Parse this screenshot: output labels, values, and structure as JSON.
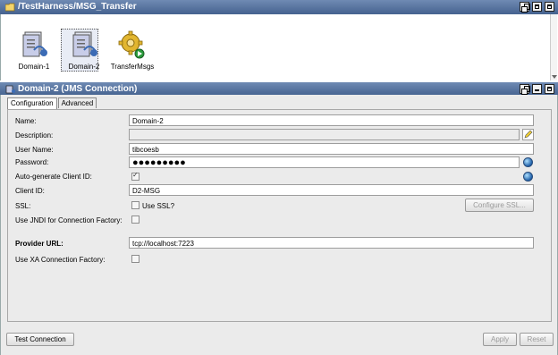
{
  "top_panel": {
    "title": "/TestHarness/MSG_Transfer",
    "resources": [
      {
        "label": "Domain-1"
      },
      {
        "label": "Domain-2"
      },
      {
        "label": "TransferMsgs"
      }
    ]
  },
  "config_panel": {
    "title": "Domain-2 (JMS Connection)",
    "tabs": [
      "Configuration",
      "Advanced"
    ]
  },
  "form": {
    "name_label": "Name:",
    "name_value": "Domain-2",
    "description_label": "Description:",
    "description_value": "",
    "username_label": "User Name:",
    "username_value": "tibcoesb",
    "password_label": "Password:",
    "password_value": "●●●●●●●●●",
    "autogen_label": "Auto-generate Client ID:",
    "autogen_checked": true,
    "clientid_label": "Client ID:",
    "clientid_value": "D2-MSG",
    "ssl_label": "SSL:",
    "ssl_checkbox_label": "Use SSL?",
    "ssl_button": "Configure SSL...",
    "jndi_label": "Use JNDI for Connection Factory:",
    "provider_label": "Provider URL:",
    "provider_value": "tcp://localhost:7223",
    "xa_label": "Use XA Connection Factory:"
  },
  "buttons": {
    "test_connection": "Test Connection",
    "apply": "Apply",
    "reset": "Reset"
  },
  "colors": {
    "header_gradient_top": "#6f8ab3",
    "header_gradient_bottom": "#45628f",
    "panel_bg": "#ebebeb"
  }
}
